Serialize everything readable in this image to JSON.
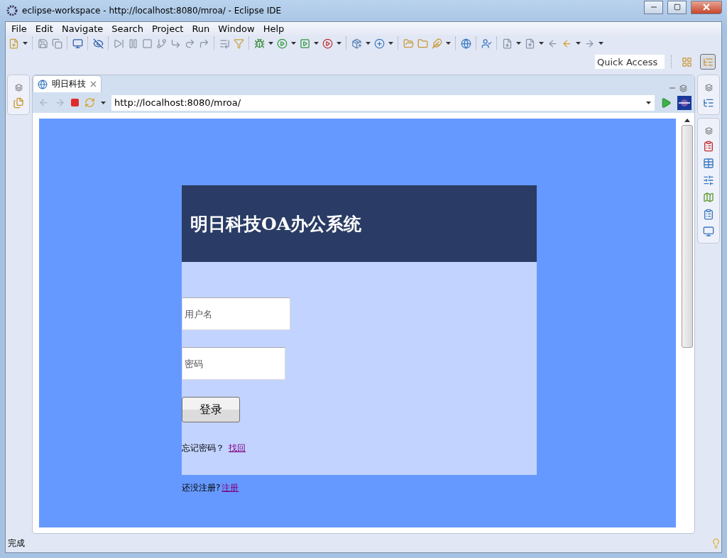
{
  "window": {
    "title": "eclipse-workspace - http://localhost:8080/mroa/ - Eclipse IDE"
  },
  "menu": [
    "File",
    "Edit",
    "Navigate",
    "Search",
    "Project",
    "Run",
    "Window",
    "Help"
  ],
  "quick_access": {
    "placeholder": "Quick Access"
  },
  "editor_tab": {
    "label": "明日科技"
  },
  "browser": {
    "url": "http://localhost:8080/mroa/"
  },
  "page": {
    "title": "明日科技OA办公系统",
    "username": {
      "placeholder": "用户名"
    },
    "password": {
      "placeholder": "密码"
    },
    "login_button": "登录",
    "forgot_text": "忘记密码？",
    "forgot_link": "找回",
    "register_text": "还没注册?",
    "register_link": "注册"
  },
  "status_bar": {
    "text": "完成"
  }
}
